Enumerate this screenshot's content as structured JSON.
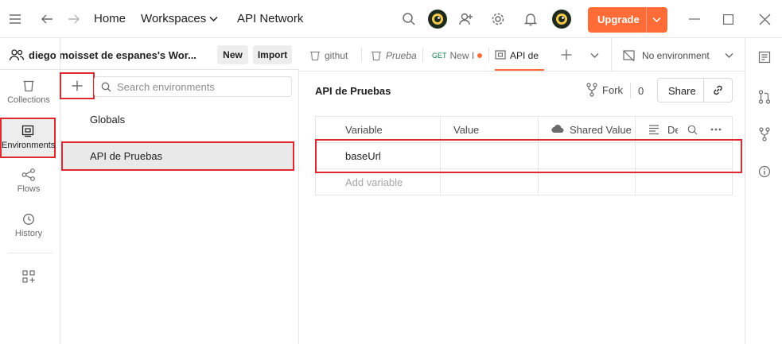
{
  "topbar": {
    "menu_icon": "hamburger-icon",
    "home": "Home",
    "workspaces": "Workspaces",
    "api_network": "API Network",
    "upgrade": "Upgrade"
  },
  "workspace": {
    "name": "diego moisset de espanes's Wor...",
    "new_label": "New",
    "import_label": "Import"
  },
  "rail": {
    "items": [
      {
        "label": "Collections",
        "icon": "collections-icon"
      },
      {
        "label": "Environments",
        "icon": "environments-icon"
      },
      {
        "label": "Flows",
        "icon": "flows-icon"
      },
      {
        "label": "History",
        "icon": "history-icon"
      }
    ]
  },
  "sidebar": {
    "search_placeholder": "Search environments",
    "environments": [
      {
        "label": "Globals"
      },
      {
        "label": "API de Pruebas"
      }
    ]
  },
  "tabs": [
    {
      "label": "githut",
      "icon": "collection-icon"
    },
    {
      "label": "Prueba",
      "icon": "collection-icon"
    },
    {
      "method": "GET",
      "label": "New I"
    },
    {
      "label": "API de",
      "icon": "environment-icon"
    }
  ],
  "environment_selector": "No environment",
  "editor": {
    "title": "API de Pruebas",
    "fork_label": "Fork",
    "fork_count": "0",
    "share_label": "Share",
    "columns": [
      "Variable",
      "Value",
      "Shared Value",
      "De"
    ],
    "rows": [
      {
        "variable": "baseUrl",
        "value": "",
        "shared_value": ""
      }
    ],
    "add_placeholder": "Add variable"
  },
  "colors": {
    "accent": "#ff6c37",
    "highlight_box": "#e0292e",
    "active_item_bg": "#e9e9e9"
  }
}
